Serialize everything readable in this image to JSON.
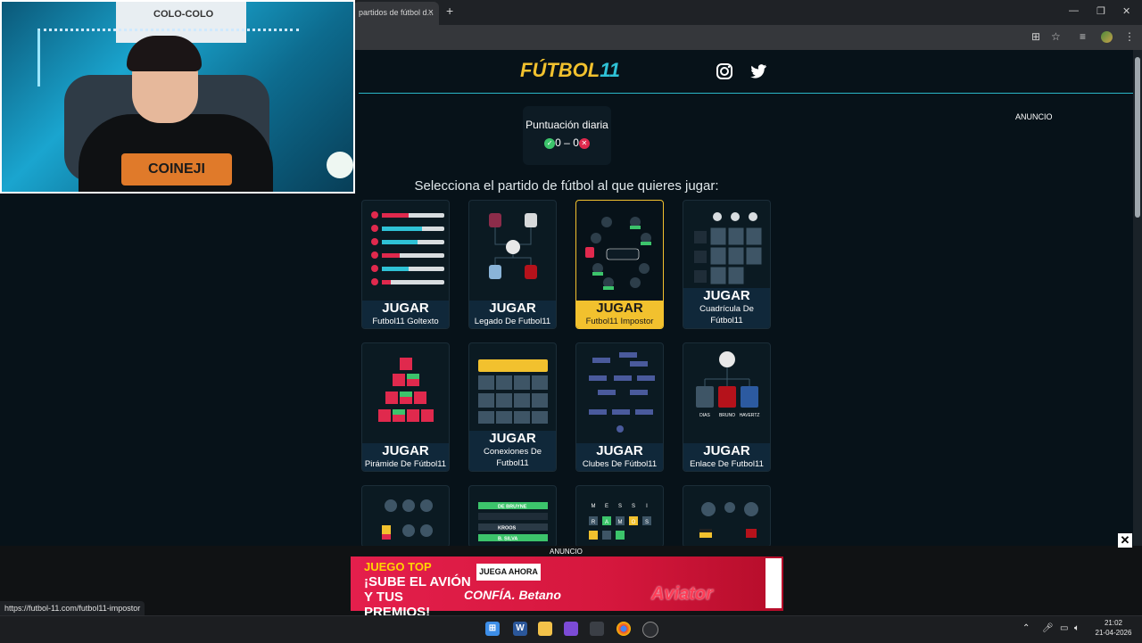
{
  "browser": {
    "tab_title": "partidos de fútbol d...",
    "tab_close": "×",
    "new_tab": "+",
    "win_min": "—",
    "win_restore": "❐",
    "win_close": "✕"
  },
  "webcam": {
    "flag_text": "COLO-COLO",
    "shirt_text": "COINEJI"
  },
  "site": {
    "logo_main": "FÚTBOL",
    "logo_num": "11",
    "score_title": "Puntuación diaria",
    "score_correct": "0",
    "score_sep": "–",
    "score_wrong": "0",
    "ad_top_label": "ANUNCIO",
    "prompt": "Selecciona el partido de fútbol al que quieres jugar:"
  },
  "cards": [
    {
      "play": "JUGAR",
      "name": "Futbol11 Goltexto"
    },
    {
      "play": "JUGAR",
      "name": "Legado De Futbol11"
    },
    {
      "play": "JUGAR",
      "name": "Futbol11 Impostor"
    },
    {
      "play": "JUGAR",
      "name": "Cuadrícula De Fútbol11"
    },
    {
      "play": "JUGAR",
      "name": "Pirámide De Fútbol11"
    },
    {
      "play": "JUGAR",
      "name": "Conexiones De Futbol11"
    },
    {
      "play": "JUGAR",
      "name": "Clubes De Fútbol11"
    },
    {
      "play": "JUGAR",
      "name": "Enlace De Futbol11"
    }
  ],
  "card_details": {
    "enlace_players": [
      "DIAS",
      "BRUNO",
      "HAVERTZ"
    ],
    "row3_players": [
      "DE BRUYNE",
      "KROOS",
      "B. SILVA"
    ],
    "row3_letters": [
      "M",
      "E",
      "S",
      "S",
      "I",
      "R",
      "A",
      "M",
      "O",
      "S"
    ]
  },
  "ad": {
    "label": "ANUNCIO",
    "close": "✕",
    "line1": "JUEGO TOP",
    "line2": "¡SUBE EL AVIÓN Y TUS PREMIOS!",
    "cta": "JUEGA AHORA",
    "brand": "CONFÍA. Betano",
    "game": "Aviator"
  },
  "status_url": "https://futbol-11.com/futbol11-impostor",
  "taskbar": {
    "time": "21:02",
    "date": "21-04-2026"
  },
  "colors": {
    "accent_yellow": "#f2c12e",
    "accent_cyan": "#2fc2d6",
    "page_bg": "#071219",
    "ad_red": "#e41f4c"
  }
}
